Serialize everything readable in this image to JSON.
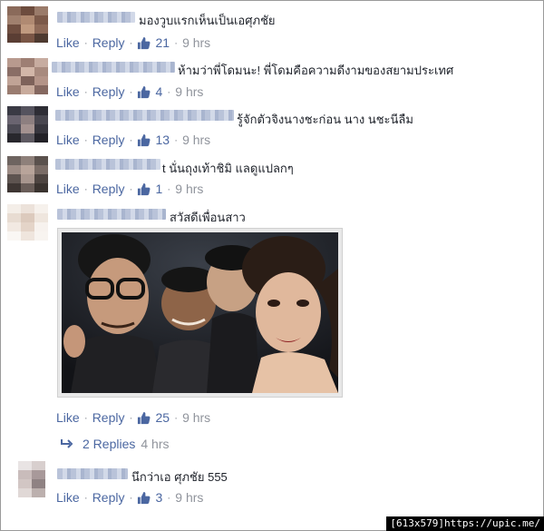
{
  "comments": [
    {
      "text": "มองวูบแรกเห็นเป็นเอศุภชัย",
      "like": "Like",
      "reply": "Reply",
      "count": "21",
      "time": "9 hrs"
    },
    {
      "text": "ห้ามว่าพี่โดมนะ! พี่โดมคือความดีงามของสยามประเทศ",
      "like": "Like",
      "reply": "Reply",
      "count": "4",
      "time": "9 hrs"
    },
    {
      "text": "รู้จักตัวจิงนางชะก่อน นาง นชะนีลืม",
      "like": "Like",
      "reply": "Reply",
      "count": "13",
      "time": "9 hrs"
    },
    {
      "text": "t นั่นถุงเท้าชิมิ แลดูแปลกๆ",
      "like": "Like",
      "reply": "Reply",
      "count": "1",
      "time": "9 hrs"
    },
    {
      "text": "สวัสดีเพื่อนสาว",
      "like": "Like",
      "reply": "Reply",
      "count": "25",
      "time": "9 hrs"
    }
  ],
  "replies_link": {
    "label": "2 Replies",
    "time": "4 hrs"
  },
  "reply_comment": {
    "text": "นึกว่าเอ ศุภชัย 555",
    "like": "Like",
    "reply": "Reply",
    "count": "3",
    "time": "9 hrs"
  },
  "watermark": "[613x579]https://upic.me/",
  "colors": {
    "link": "#4b67a1",
    "meta": "#90949c",
    "text": "#1d2129"
  }
}
